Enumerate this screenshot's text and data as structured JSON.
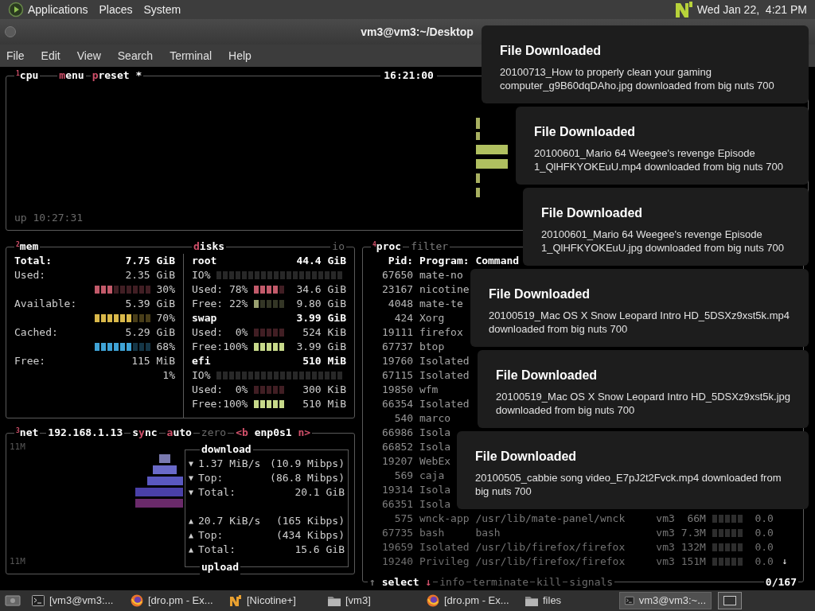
{
  "top_panel": {
    "menus": [
      "Applications",
      "Places",
      "System"
    ],
    "clock": "Wed Jan 22,  4:21 PM"
  },
  "window": {
    "title": "vm3@vm3:~/Desktop",
    "menu": [
      "File",
      "Edit",
      "View",
      "Search",
      "Terminal",
      "Help"
    ]
  },
  "cpu": {
    "number": "1",
    "name": "cpu",
    "tabs": [
      {
        "hotkey": "m",
        "rest": "enu"
      },
      {
        "hotkey": "p",
        "rest": "reset *"
      }
    ],
    "clock": "16:21:00",
    "uptime": "up 10:27:31"
  },
  "mem": {
    "number": "2",
    "name": "mem",
    "rows": [
      {
        "kind": "total",
        "label": "Total:",
        "value": "7.75 GiB"
      },
      {
        "kind": "stat",
        "label": "Used:",
        "value": "2.35 GiB"
      },
      {
        "kind": "meter",
        "level": 0.3,
        "color": "#c25a6a",
        "percent": "30%"
      },
      {
        "kind": "stat",
        "label": "Available:",
        "value": "5.39 GiB"
      },
      {
        "kind": "meter",
        "level": 0.7,
        "color": "#d9b84a",
        "percent": "70%"
      },
      {
        "kind": "stat",
        "label": "Cached:",
        "value": "5.29 GiB"
      },
      {
        "kind": "meter",
        "level": 0.68,
        "color": "#3fa3d6",
        "percent": "68%"
      },
      {
        "kind": "stat",
        "label": "Free:",
        "value": "115 MiB"
      },
      {
        "kind": "percent",
        "percent": "1%"
      }
    ]
  },
  "disks": {
    "tab": {
      "hotkey": "d",
      "rest": "isks"
    },
    "io_tab": {
      "hotkey": "i",
      "rest": "o"
    },
    "rows": [
      {
        "kind": "name",
        "label": "root",
        "value": "44.4 GiB"
      },
      {
        "kind": "io",
        "label": "IO%"
      },
      {
        "kind": "meter",
        "label": "Used:",
        "percent": "78%",
        "level": 0.78,
        "color": "#c25a6a",
        "value": "34.6 GiB"
      },
      {
        "kind": "meter",
        "label": "Free:",
        "percent": "22%",
        "level": 0.22,
        "color": "#9aa070",
        "value": "9.80 GiB"
      },
      {
        "kind": "name",
        "label": "swap",
        "value": "3.99 GiB"
      },
      {
        "kind": "meter",
        "label": "Used:",
        "percent": "0%",
        "value": "524 KiB"
      },
      {
        "kind": "meter",
        "label": "Free:",
        "percent": "100%",
        "level": 1,
        "color": "#c7d98a",
        "value": "3.99 GiB"
      },
      {
        "kind": "name",
        "label": "efi",
        "value": "510 MiB"
      },
      {
        "kind": "io",
        "label": "IO%"
      },
      {
        "kind": "meter",
        "label": "Used:",
        "percent": "0%",
        "value": "300 KiB"
      },
      {
        "kind": "meter",
        "label": "Free:",
        "percent": "100%",
        "level": 1,
        "color": "#c7d98a",
        "value": "510 MiB"
      }
    ]
  },
  "net": {
    "number": "3",
    "name": "net",
    "address": "192.168.1.13",
    "toggles": [
      {
        "before": "s",
        "hotkey": "y",
        "after": "nc",
        "on": true
      },
      {
        "hotkey": "a",
        "after": "uto",
        "on": true
      },
      {
        "hotkey": "z",
        "after": "ero",
        "on": false
      }
    ],
    "interface": {
      "prev": "<b",
      "name": "enp0s1",
      "next": "n>"
    },
    "scale_top": "11M",
    "scale_bottom": "11M",
    "download": {
      "title": "download",
      "rows": [
        {
          "arrow": "▼",
          "label": "1.37 MiB/s",
          "value": "(10.9 Mibps)"
        },
        {
          "arrow": "▼",
          "label": "Top:",
          "value": "(86.8 Mibps)"
        },
        {
          "arrow": "▼",
          "label": "Total:",
          "value": "20.1 GiB"
        }
      ]
    },
    "upload": {
      "title": "upload",
      "rows": [
        {
          "arrow": "▲",
          "label": "20.7 KiB/s",
          "value": "(165 Kibps)"
        },
        {
          "arrow": "▲",
          "label": "Top:",
          "value": "(434 Kibps)"
        },
        {
          "arrow": "▲",
          "label": "Total:",
          "value": "15.6 GiB"
        }
      ]
    }
  },
  "proc": {
    "number": "4",
    "name": "proc",
    "filter": "filter",
    "columns": [
      "Pid:",
      "Program:",
      "Command"
    ],
    "rows": [
      {
        "pid": "67650",
        "program": "mate-no"
      },
      {
        "pid": "23167",
        "program": "nicotine"
      },
      {
        "pid": "4048",
        "program": "mate-te"
      },
      {
        "pid": "424",
        "program": "Xorg"
      },
      {
        "pid": "19111",
        "program": "firefox"
      },
      {
        "pid": "67737",
        "program": "btop"
      },
      {
        "pid": "19760",
        "program": "Isolated"
      },
      {
        "pid": "67115",
        "program": "Isolated"
      },
      {
        "pid": "19850",
        "program": "wfm"
      },
      {
        "pid": "66354",
        "program": "Isolated"
      },
      {
        "pid": "540",
        "program": "marco"
      },
      {
        "pid": "66986",
        "program": "Isola"
      },
      {
        "pid": "66852",
        "program": "Isola"
      },
      {
        "pid": "19207",
        "program": "WebEx"
      },
      {
        "pid": "569",
        "program": "caja"
      },
      {
        "pid": "19314",
        "program": "Isola"
      },
      {
        "pid": "66351",
        "program": "Isola"
      },
      {
        "pid": "575",
        "program": "wnck-app",
        "command": "/usr/lib/mate-panel/wnck",
        "user": "vm3",
        "mem": "66M",
        "cpu": "0.0"
      },
      {
        "pid": "67735",
        "program": "bash",
        "command": "bash",
        "user": "vm3",
        "mem": "7.3M",
        "cpu": "0.0"
      },
      {
        "pid": "19659",
        "program": "Isolated",
        "command": "/usr/lib/firefox/firefox",
        "user": "vm3",
        "mem": "132M",
        "cpu": "0.0"
      },
      {
        "pid": "19240",
        "program": "Privileg",
        "command": "/usr/lib/firefox/firefox",
        "user": "vm3",
        "mem": "151M",
        "cpu": "0.0"
      }
    ],
    "more_indicator": "↓",
    "footer": {
      "up": "↑",
      "select": "select",
      "down": "↓",
      "actions": [
        "info",
        "terminate",
        "kill",
        "signals"
      ],
      "count": "0/167"
    }
  },
  "notifications": [
    {
      "title": "File Downloaded",
      "body": "20100713_How to properly clean your gaming computer_g9B60dqDAho.jpg downloaded from big nuts 700"
    },
    {
      "title": "File Downloaded",
      "body": "20100601_Mario 64 Weegee's revenge Episode 1_QlHFKYOKEuU.mp4 downloaded from big nuts 700"
    },
    {
      "title": "File Downloaded",
      "body": "20100601_Mario 64 Weegee's revenge Episode 1_QlHFKYOKEuU.jpg downloaded from big nuts 700"
    },
    {
      "title": "File Downloaded",
      "body": "20100519_Mac OS X Snow Leopard Intro HD_5DSXz9xst5k.mp4 downloaded from big nuts 700"
    },
    {
      "title": "File Downloaded",
      "body": "20100519_Mac OS X Snow Leopard Intro HD_5DSXz9xst5k.jpg downloaded from big nuts 700"
    },
    {
      "title": "File Downloaded",
      "body": "20100505_cabbie song video_E7pJ2t2Fvck.mp4 downloaded from big nuts 700"
    }
  ],
  "taskbar": {
    "items": [
      {
        "kind": "terminal",
        "label": "[vm3@vm3:...",
        "selected": false
      },
      {
        "kind": "browser",
        "label": "[dro.pm - Ex...",
        "selected": false
      },
      {
        "kind": "nicotine",
        "label": "[Nicotine+]",
        "selected": false
      },
      {
        "kind": "folder",
        "label": "[vm3]",
        "selected": false
      },
      {
        "kind": "browser",
        "label": "[dro.pm - Ex...",
        "selected": false
      },
      {
        "kind": "folder",
        "label": "files",
        "selected": false
      },
      {
        "kind": "terminal",
        "label": "vm3@vm3:~...",
        "selected": true
      }
    ]
  }
}
